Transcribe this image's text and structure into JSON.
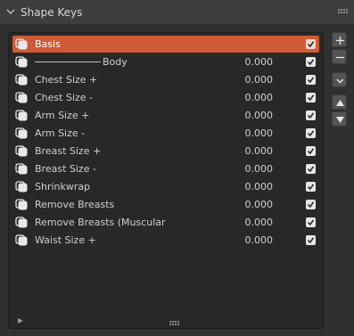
{
  "header": {
    "title": "Shape Keys"
  },
  "shape_keys": [
    {
      "name": "Basis",
      "value": "",
      "active": true,
      "checked": true,
      "separator": false
    },
    {
      "name": "Body",
      "value": "0.000",
      "active": false,
      "checked": true,
      "separator": true
    },
    {
      "name": "Chest Size +",
      "value": "0.000",
      "active": false,
      "checked": true,
      "separator": false
    },
    {
      "name": "Chest Size -",
      "value": "0.000",
      "active": false,
      "checked": true,
      "separator": false
    },
    {
      "name": "Arm Size +",
      "value": "0.000",
      "active": false,
      "checked": true,
      "separator": false
    },
    {
      "name": "Arm Size -",
      "value": "0.000",
      "active": false,
      "checked": true,
      "separator": false
    },
    {
      "name": "Breast Size +",
      "value": "0.000",
      "active": false,
      "checked": true,
      "separator": false
    },
    {
      "name": "Breast Size -",
      "value": "0.000",
      "active": false,
      "checked": true,
      "separator": false
    },
    {
      "name": "Shrinkwrap",
      "value": "0.000",
      "active": false,
      "checked": true,
      "separator": false
    },
    {
      "name": "Remove Breasts",
      "value": "0.000",
      "active": false,
      "checked": true,
      "separator": false
    },
    {
      "name": "Remove Breasts (Muscular",
      "value": "0.000",
      "active": false,
      "checked": true,
      "separator": false
    },
    {
      "name": "Waist Size +",
      "value": "0.000",
      "active": false,
      "checked": true,
      "separator": false
    }
  ],
  "side_buttons": [
    {
      "name": "add-shape-key-button",
      "icon": "plus-icon"
    },
    {
      "name": "remove-shape-key-button",
      "icon": "minus-icon"
    },
    {
      "name": "specials-menu-button",
      "icon": "chevron-down-icon"
    },
    {
      "name": "move-up-button",
      "icon": "triangle-up-icon"
    },
    {
      "name": "move-down-button",
      "icon": "triangle-down-icon"
    }
  ],
  "colors": {
    "active_row": "#cf5b35",
    "panel_bg": "#303030",
    "list_bg": "#282828"
  }
}
